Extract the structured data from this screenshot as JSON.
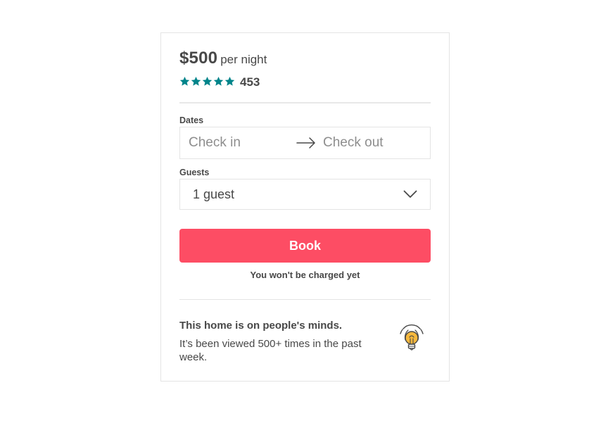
{
  "listing": {
    "price": "$500",
    "price_unit": "per night",
    "rating_stars": 5,
    "review_count": "453"
  },
  "form": {
    "dates_label": "Dates",
    "checkin_placeholder": "Check in",
    "checkout_placeholder": "Check out",
    "guests_label": "Guests",
    "guests_value": "1 guest",
    "book_label": "Book",
    "charge_note": "You won't be charged yet"
  },
  "promo": {
    "title": "This home is on people's minds.",
    "body": "It’s been viewed 500+ times in the past week."
  },
  "icons": {
    "star": "star-icon",
    "arrow": "arrow-right-icon",
    "chevron": "chevron-down-icon",
    "bulb": "lightbulb-icon"
  },
  "colors": {
    "star": "#00848a",
    "book_button": "#fd4d64",
    "bulb_fill": "#f5b83d",
    "text": "#484848",
    "border": "#e4e4e4"
  }
}
